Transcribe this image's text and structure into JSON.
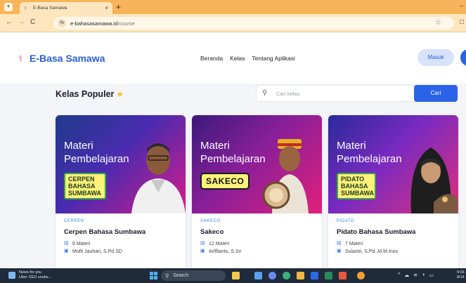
{
  "browser": {
    "tab_title": "E-Basa Samawa",
    "tab_close": "×",
    "new_tab": "+",
    "url_host": "e-bahasasamawa.id",
    "url_path": "/course"
  },
  "site": {
    "logo_text": "E-Basa Samawa",
    "nav": [
      "Beranda",
      "Kelas",
      "Tentang Aplikasi"
    ],
    "login_label": "Masuk"
  },
  "section": {
    "title": "Kelas Populer",
    "search_placeholder": "Cari kelas",
    "search_button": "Cari"
  },
  "cards": [
    {
      "thumb_line1": "Materi",
      "thumb_line2": "Pembelajaran",
      "thumb_tag": "CERPEN BAHASA SUMBAWA",
      "category": "CERPEN",
      "name": "Cerpen Bahasa Sumbawa",
      "materi": "6 Materi",
      "author": "Mufti Jauhari, S.Pd.SD"
    },
    {
      "thumb_line1": "Materi",
      "thumb_line2": "Pembelajaran",
      "thumb_tag": "SAKECO",
      "category": "SAKECO",
      "name": "Sakeco",
      "materi": "12 Materi",
      "author": "Ariffianto, S.Sn"
    },
    {
      "thumb_line1": "Materi",
      "thumb_line2": "Pembelajaran",
      "thumb_tag": "PIDATO BAHASA SUMBAWA",
      "category": "PIDATO",
      "name": "Pidato Bahasa Sumbawa",
      "materi": "7 Materi",
      "author": "Sulastri, S.Pd.,M.M.Inov."
    }
  ],
  "taskbar": {
    "news_line1": "News for you",
    "news_line2": "Uber CEO snubs...",
    "search_label": "Search",
    "time": "9:03",
    "date": "8/14"
  },
  "colors": {
    "brand_blue": "#2a63e8",
    "tabbar_orange": "#f7b45a",
    "category_blue": "#2a8de0"
  }
}
